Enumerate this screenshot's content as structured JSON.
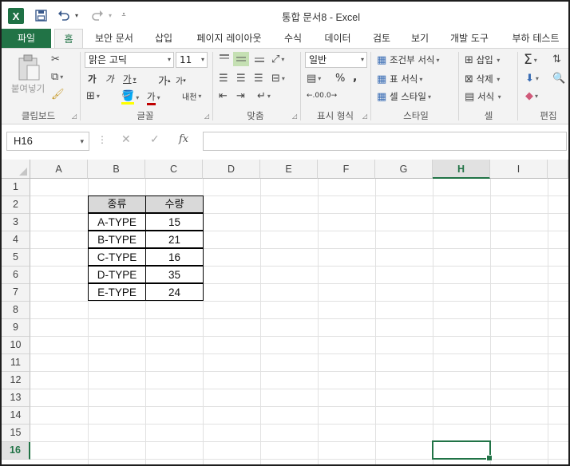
{
  "titlebar": {
    "app_icon": "X",
    "title": "통합 문서8 - Excel",
    "qat_icons": [
      "save-icon",
      "undo-icon",
      "redo-icon",
      "customize-icon"
    ]
  },
  "tabs": [
    "파일",
    "홈",
    "보안 문서",
    "삽입",
    "페이지 레이아웃",
    "수식",
    "데이터",
    "검토",
    "보기",
    "개발 도구",
    "부하 테스트"
  ],
  "ribbon": {
    "clipboard": {
      "paste": "붙여넣기",
      "label": "클립보드"
    },
    "font": {
      "name": "맑은 고딕",
      "size": "11",
      "bold": "가",
      "italic": "가",
      "underline": "가",
      "grow": "가",
      "shrink": "가",
      "color_btn": "가",
      "phonetic": "내천",
      "label": "글꼴",
      "font_color": "#c00000",
      "fill_color": "#ffff00"
    },
    "align": {
      "label": "맞춤"
    },
    "number": {
      "format": "일반",
      "percent": "%",
      "comma": ",",
      "dec_inc": ".00",
      "dec_dec": ".0",
      "label": "표시 형식"
    },
    "styles": {
      "cond": "조건부 서식",
      "table": "표 서식",
      "cell": "셀 스타일",
      "label": "스타일"
    },
    "cells": {
      "insert": "삽입",
      "delete": "삭제",
      "format": "서식",
      "label": "셀"
    },
    "editing": {
      "label": "편집"
    }
  },
  "formula": {
    "namebox": "H16",
    "fx": "fx",
    "value": ""
  },
  "sheet": {
    "columns": [
      "A",
      "B",
      "C",
      "D",
      "E",
      "F",
      "G",
      "H",
      "I"
    ],
    "rows": [
      "1",
      "2",
      "3",
      "4",
      "5",
      "6",
      "7",
      "8",
      "9",
      "10",
      "11",
      "12",
      "13",
      "14",
      "15",
      "16"
    ],
    "selected_col": "H",
    "selected_row": "16",
    "table": {
      "headers": [
        "종류",
        "수량"
      ],
      "rows": [
        [
          "A-TYPE",
          "15"
        ],
        [
          "B-TYPE",
          "21"
        ],
        [
          "C-TYPE",
          "16"
        ],
        [
          "D-TYPE",
          "35"
        ],
        [
          "E-TYPE",
          "24"
        ]
      ]
    }
  },
  "colors": {
    "accent": "#217346"
  }
}
